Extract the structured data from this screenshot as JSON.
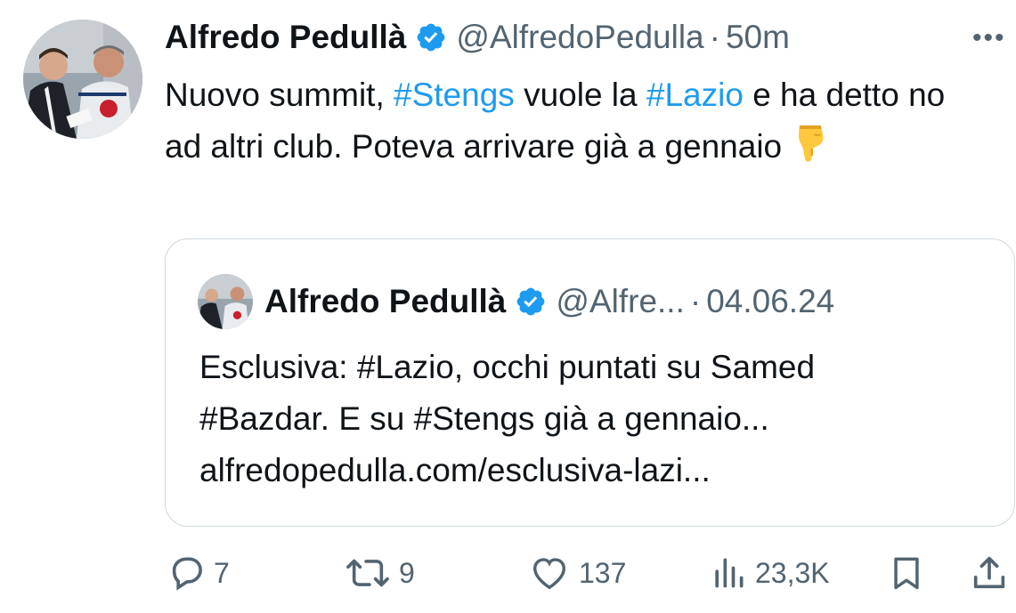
{
  "tweet": {
    "author_name": "Alfredo Pedullà",
    "handle": "@AlfredoPedulla",
    "separator": "·",
    "time": "50m",
    "more": "•••",
    "text_parts": [
      "Nuovo summit, ",
      "#Stengs",
      " vuole la ",
      "#Lazio",
      " e ha detto no ad altri club. Poteva arrivare già a gennaio"
    ],
    "emoji": "backhand-index-pointing-down"
  },
  "quote": {
    "author_name": "Alfredo Pedullà",
    "handle": "@Alfre...",
    "separator": "·",
    "date": "04.06.24",
    "line1": "Esclusiva: #Lazio, occhi puntati su Samed",
    "line2": "#Bazdar. E su #Stengs già a gennaio...",
    "line3": "alfredopedulla.com/esclusiva-lazi..."
  },
  "actions": {
    "replies": "7",
    "reposts": "9",
    "likes": "137",
    "views": "23,3K"
  },
  "colors": {
    "accent": "#1d9bf0",
    "secondary_text": "#536471",
    "border": "#cfd9de"
  }
}
